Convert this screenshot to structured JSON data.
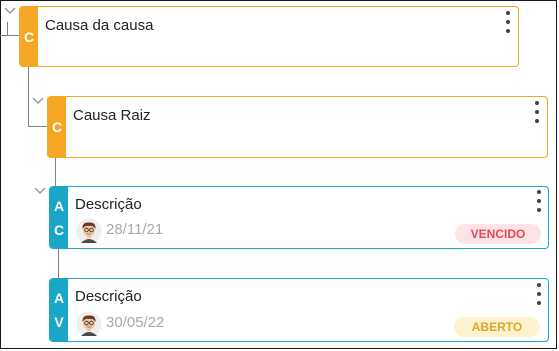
{
  "nodes": [
    {
      "title": "Causa da causa",
      "type_letters": [
        "C"
      ],
      "accent": "#f5a623"
    },
    {
      "title": "Causa Raiz",
      "type_letters": [
        "C"
      ],
      "accent": "#f5a623"
    },
    {
      "title": "Descrição",
      "type_letters": [
        "A",
        "C"
      ],
      "accent": "#1aa6c8",
      "date": "28/11/21",
      "status": "VENCIDO",
      "status_color": "#e24b5a",
      "status_bg": "#fde3e6"
    },
    {
      "title": "Descrição",
      "type_letters": [
        "A",
        "V"
      ],
      "accent": "#1aa6c8",
      "date": "30/05/22",
      "status": "ABERTO",
      "status_color": "#e0a82a",
      "status_bg": "#fdf2cf"
    }
  ],
  "icons": {
    "expand": "chevron-down-icon",
    "menu": "more-vertical-icon",
    "avatar": "user-avatar"
  }
}
